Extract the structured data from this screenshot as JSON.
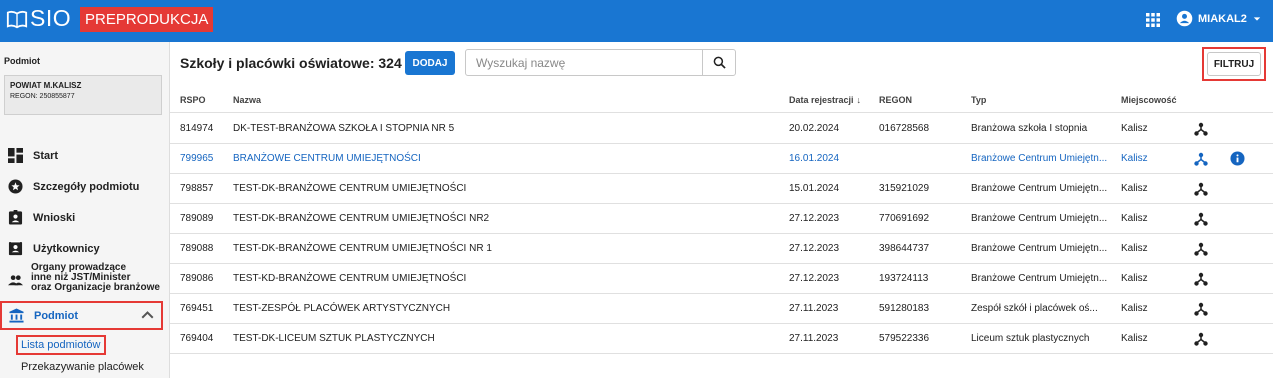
{
  "header": {
    "logo_text": "SIO",
    "env_badge": "PREPRODUKCJA",
    "apps_icon": "grid-icon",
    "user_label": "MIAKAL2",
    "colors": {
      "primary": "#1976d2",
      "badge": "#e53935"
    }
  },
  "sidebar": {
    "heading": "Podmiot",
    "entity": {
      "name": "POWIAT M.KALISZ",
      "regon": "REGON: 250855877"
    },
    "items": [
      {
        "label": "Start",
        "icon": "dashboard-icon"
      },
      {
        "label": "Szczegóły podmiotu",
        "icon": "info-star-icon"
      },
      {
        "label": "Wnioski",
        "icon": "assignment-ind-icon"
      },
      {
        "label": "Użytkownicy",
        "icon": "contact-card-icon"
      },
      {
        "label_lines": [
          "Organy prowadzące",
          "inne niż JST/Minister",
          "oraz Organizacje branżowe"
        ],
        "icon": "people-icon"
      },
      {
        "label": "Podmiot",
        "icon": "bank-icon",
        "expanded": true
      }
    ],
    "subitems": [
      "Lista podmiotów",
      "Przekazywanie placówek"
    ]
  },
  "main": {
    "title": "Szkoły i placówki oświatowe: 324",
    "add_label": "DODAJ",
    "search_placeholder": "Wyszukaj nazwę",
    "filter_label": "FILTRUJ",
    "columns": [
      "RSPO",
      "Nazwa",
      "Data rejestracji",
      "REGON",
      "Typ",
      "Miejscowość"
    ],
    "sort_indicator": "↓",
    "rows": [
      {
        "rspo": "814974",
        "name": "DK-TEST-BRANŻOWA SZKOŁA I STOPNIA NR 5",
        "date": "20.02.2024",
        "regon": "016728568",
        "type": "Branżowa szkoła I stopnia",
        "city": "Kalisz"
      },
      {
        "rspo": "799965",
        "name": "BRANŻOWE CENTRUM UMIEJĘTNOŚCI",
        "date": "16.01.2024",
        "regon": "",
        "type": "Branżowe Centrum Umiejętn...",
        "city": "Kalisz",
        "highlight": true,
        "info": true
      },
      {
        "rspo": "798857",
        "name": "TEST-DK-BRANŻOWE CENTRUM UMIEJĘTNOŚCI",
        "date": "15.01.2024",
        "regon": "315921029",
        "type": "Branżowe Centrum Umiejętn...",
        "city": "Kalisz"
      },
      {
        "rspo": "789089",
        "name": "TEST-DK-BRANŻOWE CENTRUM UMIEJĘTNOŚCI NR2",
        "date": "27.12.2023",
        "regon": "770691692",
        "type": "Branżowe Centrum Umiejętn...",
        "city": "Kalisz"
      },
      {
        "rspo": "789088",
        "name": "TEST-DK-BRANŻOWE CENTRUM UMIEJĘTNOŚCI NR 1",
        "date": "27.12.2023",
        "regon": "398644737",
        "type": "Branżowe Centrum Umiejętn...",
        "city": "Kalisz"
      },
      {
        "rspo": "789086",
        "name": "TEST-KD-BRANŻOWE CENTRUM UMIEJĘTNOŚCI",
        "date": "27.12.2023",
        "regon": "193724113",
        "type": "Branżowe Centrum Umiejętn...",
        "city": "Kalisz"
      },
      {
        "rspo": "769451",
        "name": "TEST-ZESPÓŁ PLACÓWEK ARTYSTYCZNYCH",
        "date": "27.11.2023",
        "regon": "591280183",
        "type": "Zespół szkół i placówek oś...",
        "city": "Kalisz"
      },
      {
        "rspo": "769404",
        "name": "TEST-DK-LICEUM SZTUK PLASTYCZNYCH",
        "date": "27.11.2023",
        "regon": "579522336",
        "type": "Liceum sztuk plastycznych",
        "city": "Kalisz"
      }
    ]
  }
}
